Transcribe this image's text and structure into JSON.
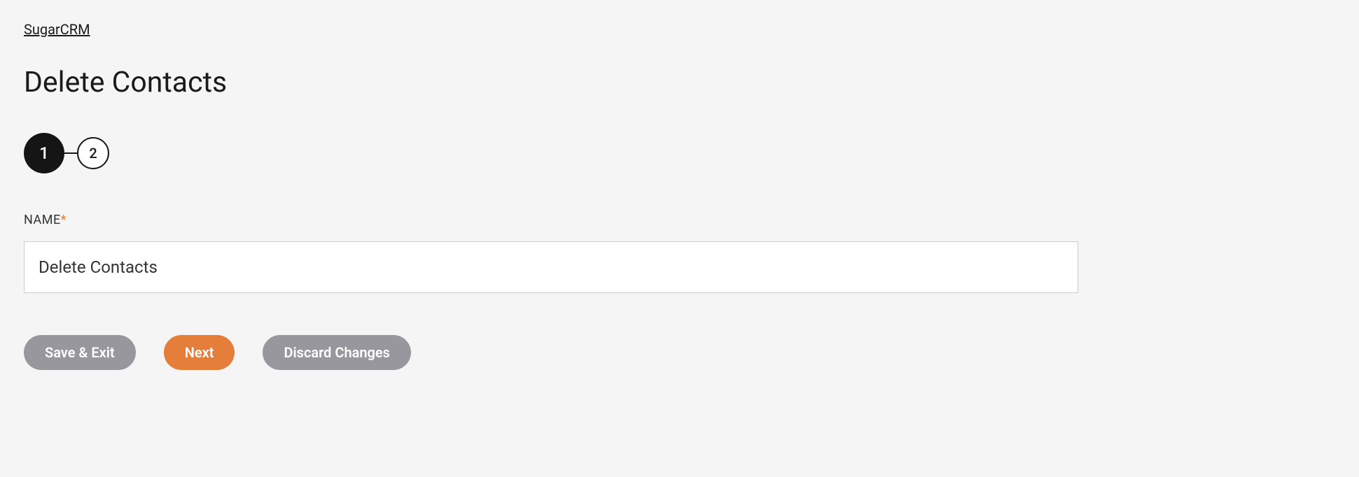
{
  "breadcrumb": {
    "label": "SugarCRM"
  },
  "page": {
    "title": "Delete Contacts"
  },
  "steps": {
    "current": "1",
    "next": "2"
  },
  "form": {
    "name_label": "NAME",
    "required_mark": "*",
    "name_value": "Delete Contacts"
  },
  "buttons": {
    "save_exit": "Save & Exit",
    "next": "Next",
    "discard": "Discard Changes"
  }
}
